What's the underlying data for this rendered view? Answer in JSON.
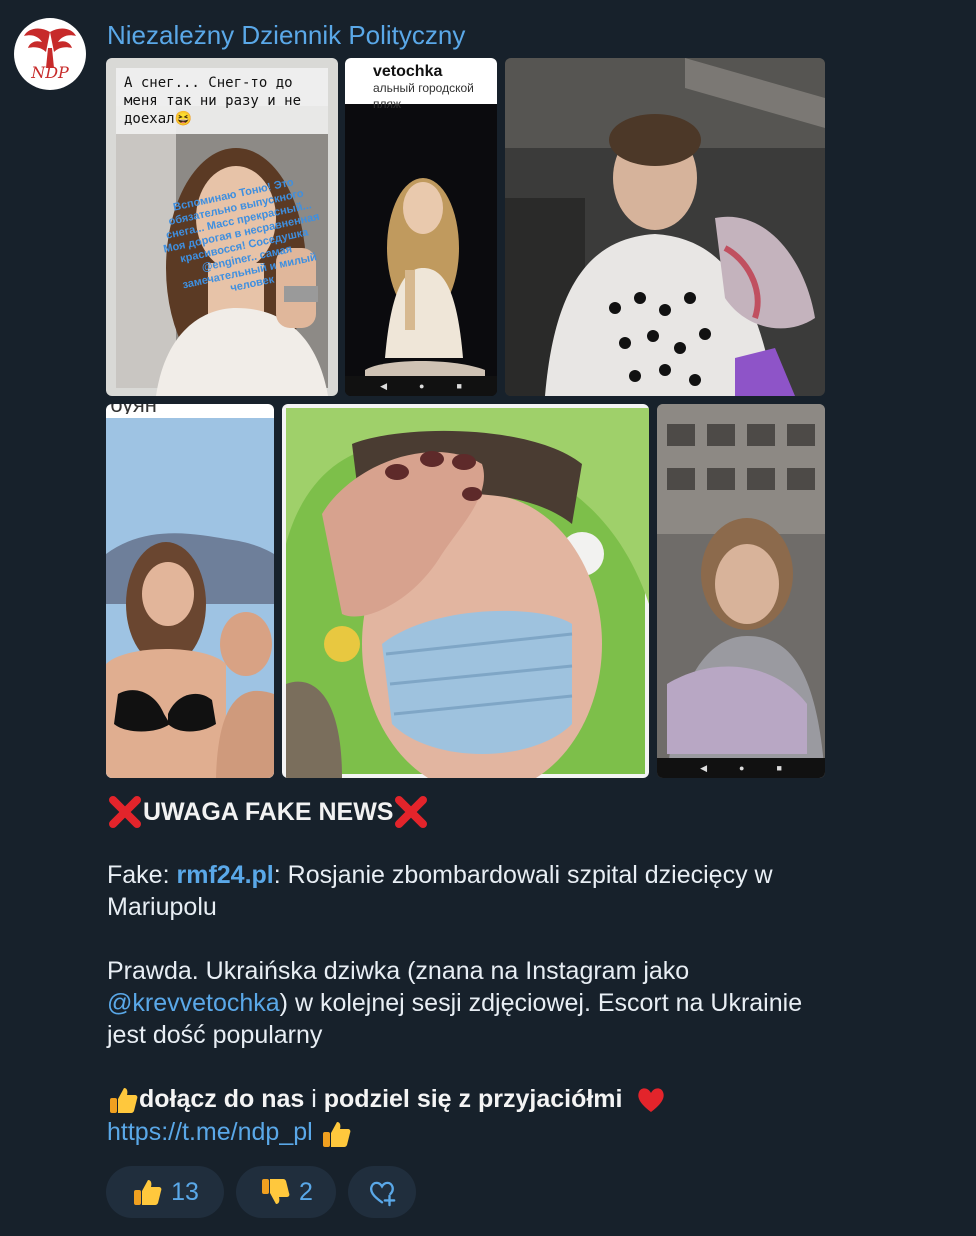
{
  "channel": {
    "name": "Niezależny Dziennik Polityczny",
    "avatar_text": "NDP"
  },
  "album": {
    "story1": {
      "caption": "А снег... Снег-то до меня так ни разу и не доехал😆",
      "overlay": "Вспоминаю Тоню! Это обязательно выпускного снега... Масс прекрасный... Моя дорогая в несравненная красивосся! Соседушка @enginer.. самая замечательный и милый человек"
    },
    "story2": {
      "username": "vetochka",
      "subtitle": "альный городской пляж"
    },
    "story4": {
      "cut_text": "буян"
    }
  },
  "message": {
    "headline": "UWAGA FAKE NEWS",
    "fake_prefix": "Fake: ",
    "fake_link": "rmf24.pl",
    "fake_rest": ": Rosjanie zbombardowali szpital dziecięcy w Mariupolu",
    "truth_start": "Prawda. Ukraińska dziwka (znana na Instagram jako ",
    "truth_mention": "@krevvetochka",
    "truth_end": ") w kolejnej sesji zdjęciowej. Escort na Ukrainie jest dość popularny",
    "cta_part1": "dołącz do nas",
    "cta_mid": " i ",
    "cta_part2": "podziel się z przyjaciółmi",
    "cta_url": "https://t.me/ndp_pl"
  },
  "reactions": [
    {
      "icon": "thumbs-up-icon",
      "count": "13"
    },
    {
      "icon": "thumbs-down-icon",
      "count": "2"
    },
    {
      "icon": "add-reaction-icon",
      "count": ""
    }
  ],
  "colors": {
    "background": "#17212b",
    "accent": "#5aa8e8",
    "reaction_bg": "#202e3d"
  }
}
